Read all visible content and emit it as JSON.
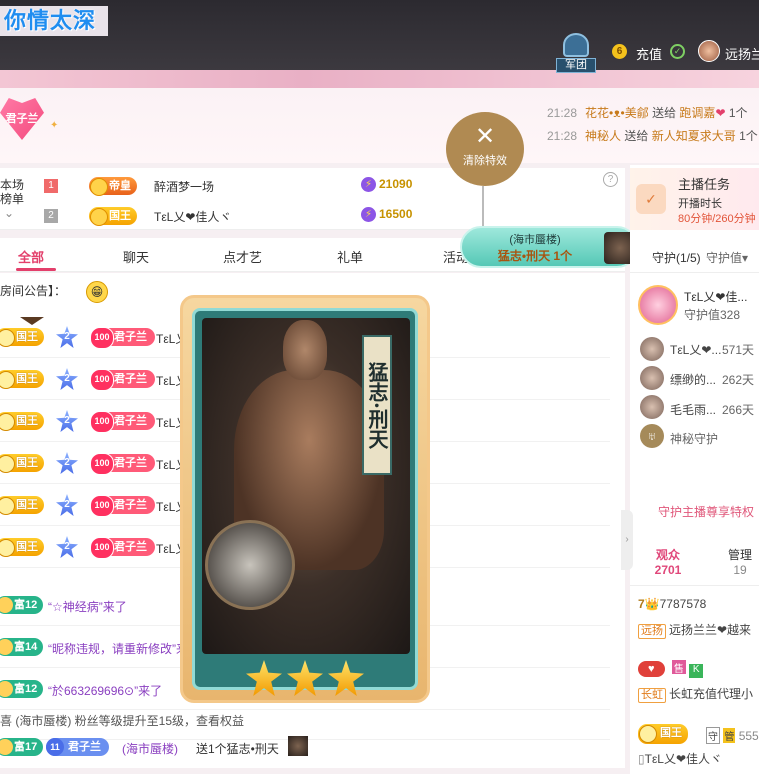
{
  "room": {
    "title": "你情太深"
  },
  "topbar": {
    "legion_label": "军团",
    "coin_count": "6",
    "recharge_label": "充值",
    "user_name": "远扬兰"
  },
  "host": {
    "badge_name": "君子兰"
  },
  "gift_feed": [
    {
      "time": "21:28",
      "sender": "花花•ᴥ•美鄃",
      "verb": "送给",
      "receiver": "跑调嘉",
      "suffix": "1个"
    },
    {
      "time": "21:28",
      "sender": "神秘人",
      "verb": "送给",
      "receiver": "新人知夏求大哥",
      "suffix": "1个"
    }
  ],
  "rank": {
    "label_line1": "本场",
    "label_line2": "榜单",
    "rows": [
      {
        "no": "1",
        "badge": "帝皇",
        "name": "醉酒梦一场",
        "score": "21090"
      },
      {
        "no": "2",
        "badge": "国王",
        "name": "TεL乂❤佳人ヾ",
        "score": "16500"
      }
    ]
  },
  "tabs": [
    "全部",
    "聊天",
    "点才艺",
    "礼单",
    "活动"
  ],
  "announce": "房间公告】：",
  "chat": {
    "king_label": "国王",
    "star_level": "2",
    "fan_level": "100",
    "fan_name": "君子兰",
    "user_short": "TεL乂",
    "rich_rows": [
      {
        "level": "富12",
        "text": "“☆神经病”来了"
      },
      {
        "level": "富14",
        "text": "“昵称违规，请重新修改”来了"
      },
      {
        "level": "富12",
        "text": "“於663269696⊙”来了"
      }
    ],
    "fan_upgrade": "喜 (海市蜃楼) 粉丝等级提升至15级，查看权益",
    "last_row": {
      "level": "富17",
      "fan_level": "11",
      "fan_name": "君子兰",
      "user": "(海市蜃楼)",
      "text": "送1个猛志•刑天"
    }
  },
  "card": {
    "title": "猛志·刑天",
    "stars": 3
  },
  "effect": {
    "clear_label": "清除特效",
    "sender": "(海市蜃楼)",
    "gift": "猛志•刑天 1个"
  },
  "task": {
    "title": "主播任务",
    "subtitle": "开播时长",
    "progress": "80分钟/260分钟"
  },
  "guard": {
    "tab_label": "守护(1/5)",
    "value_label": "守护值▾",
    "top": {
      "name": "TεL乂❤佳...",
      "value": "守护值328"
    },
    "list": [
      {
        "name": "TεL乂❤...",
        "value": "571天"
      },
      {
        "name": "缥缈的...",
        "value": "262天"
      },
      {
        "name": "毛毛雨...",
        "value": "266天"
      }
    ],
    "mystery": "神秘守护",
    "privilege": "守护主播尊享特权"
  },
  "audience": {
    "label": "观众",
    "count": "2701",
    "mgr_label": "管理",
    "mgr_count": "19"
  },
  "right_feed": {
    "id_line": "7787578",
    "tag1": "远扬",
    "name1": "远扬兰兰❤越来",
    "tag2": "长虹",
    "name2": "长虹充值代理小",
    "king_label": "国王",
    "king_num": "555",
    "last_name": "TεL乂❤佳人ヾ"
  }
}
